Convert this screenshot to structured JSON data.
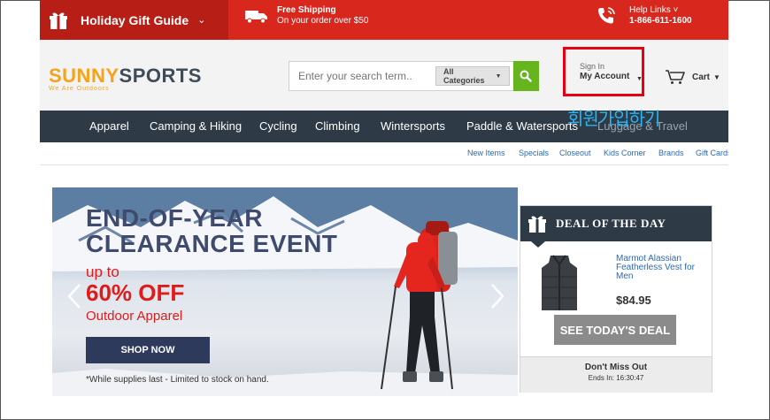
{
  "colors": {
    "topbar_red": "#d8281d",
    "topbar_dark_red": "#b71f16",
    "nav_bg": "#2e3a45",
    "search_button": "#66b51f",
    "account_highlight": "#e60012",
    "annotation": "#28b5f5",
    "link_blue": "#2a6ab3",
    "logo_orange": "#f7a21b",
    "logo_slate": "#3f4b58",
    "hero_red": "#e01b1b"
  },
  "topbar": {
    "gift_guide_label": "Holiday Gift Guide",
    "gift_icon": "gift-icon",
    "shipping_title": "Free Shipping",
    "shipping_sub": "On your order over $50",
    "shipping_icon": "truck-icon",
    "help_title": "Help Links ˅",
    "help_phone": "1-866-611-1600",
    "help_icon": "phone-icon"
  },
  "header": {
    "logo_sunny": "SUNNY",
    "logo_sports": "SPORTS",
    "logo_tagline": "We Are Outdoors",
    "search_placeholder": "Enter your search term..",
    "search_category": "All Categories",
    "search_icon": "search-icon",
    "account_small": "Sign In",
    "account_main": "My Account",
    "cart_label": "Cart",
    "cart_icon": "cart-icon"
  },
  "annotation_text": "회원가입하기",
  "nav": {
    "items": [
      "Apparel",
      "Camping & Hiking",
      "Cycling",
      "Climbing",
      "Wintersports",
      "Paddle & Watersports",
      "Luggage & Travel"
    ]
  },
  "sublinks": [
    "New Items",
    "Specials",
    "Closeout",
    "Kids Corner",
    "Brands",
    "Gift Cards"
  ],
  "hero": {
    "title_line1": "END-OF-YEAR",
    "title_line2": "CLEARANCE EVENT",
    "up_to": "up to",
    "discount": "60% OFF",
    "subtitle": "Outdoor Apparel",
    "button": "SHOP NOW",
    "note": "*While supplies last - Limited to stock on hand."
  },
  "deal": {
    "title": "DEAL OF THE DAY",
    "product_name": "Marmot Alassian Featherless Vest for Men",
    "price": "$84.95",
    "button": "SEE TODAY'S DEAL",
    "footer_title": "Don't Miss Out",
    "footer_ends": "Ends In: 16:30:47"
  }
}
